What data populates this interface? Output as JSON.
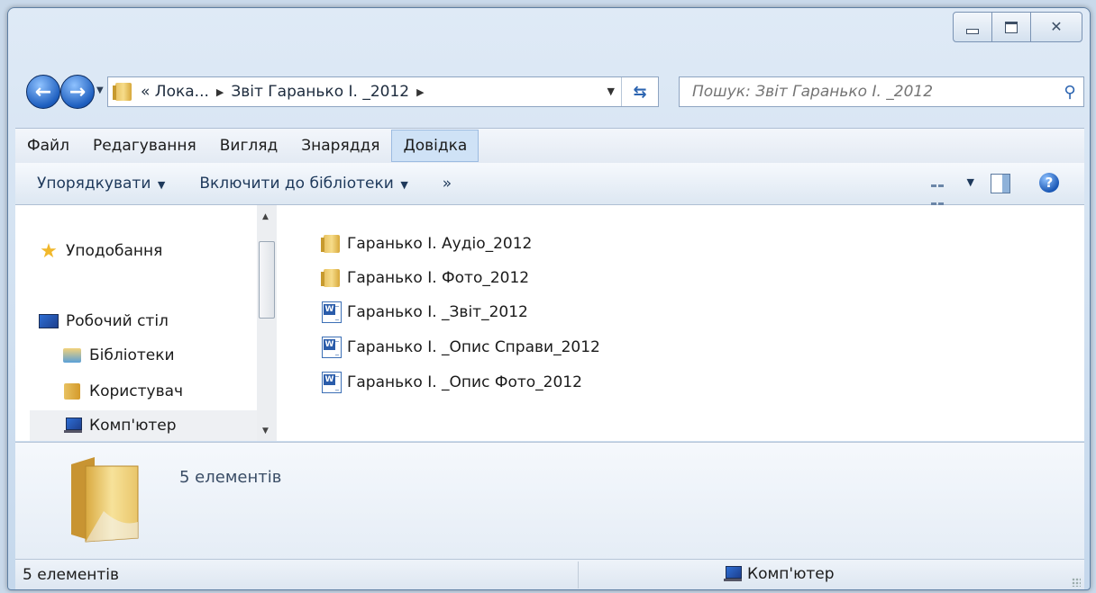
{
  "window": {
    "caption": {
      "minimize": "—",
      "maximize": "□",
      "close": "✕"
    }
  },
  "address": {
    "crumbs": [
      "« Лока...",
      "Звіт Гаранько І. _2012"
    ],
    "search_placeholder": "Пошук: Звіт Гаранько І. _2012"
  },
  "menu": {
    "items": [
      "Файл",
      "Редагування",
      "Вигляд",
      "Знаряддя",
      "Довідка"
    ],
    "active": "Довідка"
  },
  "toolbar": {
    "organize": "Упорядкувати",
    "include_library": "Включити до бібліотеки",
    "more": "»"
  },
  "nav": {
    "items": [
      {
        "label": "Уподобання",
        "icon": "star-icon"
      },
      {
        "label": "Робочий стіл",
        "icon": "desktop-icon"
      },
      {
        "label": "Бібліотеки",
        "icon": "libraries-icon"
      },
      {
        "label": "Користувач",
        "icon": "user-folder-icon"
      },
      {
        "label": "Комп'ютер",
        "icon": "computer-icon",
        "selected": true
      }
    ]
  },
  "files": [
    {
      "name": "Гаранько І. Аудіо_2012",
      "type": "folder"
    },
    {
      "name": "Гаранько І. Фото_2012",
      "type": "folder"
    },
    {
      "name": "Гаранько І. _Звіт_2012",
      "type": "word"
    },
    {
      "name": "Гаранько І. _Опис Справи_2012",
      "type": "word"
    },
    {
      "name": "Гаранько І. _Опис Фото_2012",
      "type": "word"
    }
  ],
  "details": {
    "count": "5 елементів"
  },
  "status": {
    "left": "5 елементів",
    "right": "Комп'ютер"
  },
  "colors": {
    "accent": "#1e5fbf",
    "folder": "#e8c262"
  }
}
